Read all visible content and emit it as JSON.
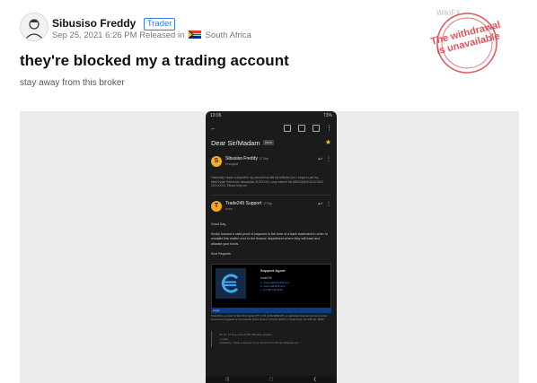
{
  "post": {
    "username": "Sibusiso Freddy",
    "badge": "Trader",
    "date": "Sep 25, 2021 6:26 PM",
    "released_prefix": "Released in",
    "country": "South Africa",
    "title": "they're blocked my a trading account",
    "subtitle": "stay away from this broker"
  },
  "watermark": {
    "site": "WikiFX",
    "stamp_line1": "The withdrawal",
    "stamp_line2": "is unavailable"
  },
  "phone": {
    "status_time": "13:06",
    "status_right": "73%",
    "subject": "Dear Sir/Madam",
    "inbox_label": "Inbox",
    "messages": [
      {
        "initial": "S",
        "color": "#f2b01e",
        "sender": "Sibusiso Freddy",
        "date": "17 Sep",
        "to": "to support",
        "snippet": "Yesterday I made a deposit to my account but still not reflected yet, I forgot to put my MetaTrader Reference description 0123XXXX I only entered the ABSA BANK ACCOUNT 012XXXXX. Please help me."
      },
      {
        "initial": "T",
        "color": "#f5a623",
        "sender": "Trade245 Support",
        "date": "17 Sep",
        "to": "to me"
      }
    ],
    "greeting": "Good Day,",
    "body": "Kindly forward a valid proof of payment in the form of a bank statement in order to escalate this matter over to the finance department where they will track and allocate your funds.",
    "regards": "Kind Regards",
    "signature": {
      "role": "Support Agent",
      "company": "trade245",
      "lines": [
        "e: support@trade245.com",
        "w: www.trade245.com",
        "t: +27 087 630 8249"
      ],
      "bar_label": "Legal"
    },
    "disclaimer": "Trade245 is a product of Red Pine Capital (PTY) LTD (2016/398911/07) an authorised financial services provider licensed and regulated by the Financial Sector Conduct Authority (FSCA) in South Africa, with FSP No. 48458.",
    "quoted_header": "On Fri, 17 Sep at 8:12 PM, Sibusiso Freddy <",
    "quoted_sub": "> wrote:",
    "quoted_line": "Yesterday I made a deposit to my account but still not reflected yet, I"
  }
}
